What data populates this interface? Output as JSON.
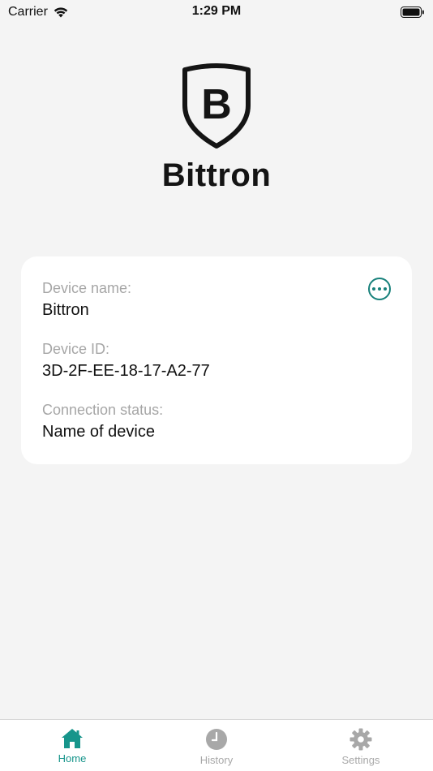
{
  "status_bar": {
    "carrier": "Carrier",
    "time": "1:29 PM"
  },
  "brand": {
    "logo_letter": "B",
    "name": "Bittron"
  },
  "device_card": {
    "fields": [
      {
        "label": "Device name:",
        "value": "Bittron"
      },
      {
        "label": "Device ID:",
        "value": "3D-2F-EE-18-17-A2-77"
      },
      {
        "label": "Connection status:",
        "value": "Name of device"
      }
    ],
    "more_icon": "ellipsis-circle-icon"
  },
  "tab_bar": {
    "tabs": [
      {
        "label": "Home",
        "icon": "home-icon",
        "active": true
      },
      {
        "label": "History",
        "icon": "clock-icon",
        "active": false
      },
      {
        "label": "Settings",
        "icon": "gear-icon",
        "active": false
      }
    ]
  },
  "colors": {
    "accent": "#17958b",
    "background": "#f4f4f4",
    "card": "#ffffff",
    "label_gray": "#a6a6a6",
    "inactive_tab": "#a8a8a8"
  }
}
